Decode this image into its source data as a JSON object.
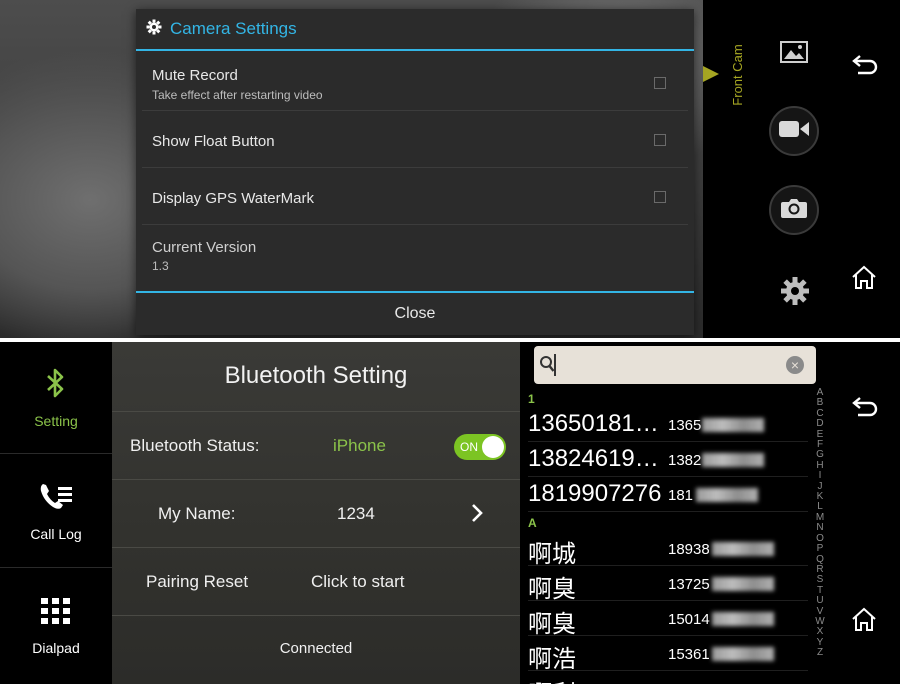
{
  "camera": {
    "dialog": {
      "title": "Camera Settings",
      "items": [
        {
          "title": "Mute Record",
          "subtitle": "Take effect after restarting video",
          "checked": false
        },
        {
          "title": "Show Float Button",
          "subtitle": "",
          "checked": false
        },
        {
          "title": "Display GPS WaterMark",
          "subtitle": "",
          "checked": false
        },
        {
          "title": "Current Version",
          "subtitle": "1.3"
        }
      ],
      "close_label": "Close"
    },
    "side": {
      "front_cam_label": "Front Cam",
      "icons": [
        "gallery-icon",
        "video-camera-icon",
        "camera-icon",
        "gear-icon",
        "back-icon",
        "home-icon"
      ]
    }
  },
  "bluetooth": {
    "nav": [
      {
        "label": "Setting",
        "icon": "bluetooth-icon",
        "active": true
      },
      {
        "label": "Call Log",
        "icon": "call-log-icon",
        "active": false
      },
      {
        "label": "Dialpad",
        "icon": "dialpad-icon",
        "active": false
      }
    ],
    "title": "Bluetooth Setting",
    "status_label": "Bluetooth Status:",
    "status_value": "iPhone",
    "toggle_label": "ON",
    "my_name_label": "My Name:",
    "my_name_value": "1234",
    "pairing_reset_label": "Pairing Reset",
    "pairing_reset_action": "Click to start",
    "connection_status": "Connected"
  },
  "contacts": {
    "search": {
      "placeholder": ""
    },
    "groups": [
      {
        "header": "1",
        "entries": [
          {
            "name": "13650181…",
            "number": "1365"
          },
          {
            "name": "13824619…",
            "number": "1382"
          },
          {
            "name": "1819907276",
            "number": "181"
          }
        ]
      },
      {
        "header": "A",
        "entries": [
          {
            "name": "啊城",
            "number": "18938"
          },
          {
            "name": "啊臭",
            "number": "13725"
          },
          {
            "name": "啊臭",
            "number": "15014"
          },
          {
            "name": "啊浩",
            "number": "15361"
          },
          {
            "name": "啊利",
            "number": ""
          }
        ]
      }
    ],
    "index_letters": [
      "A",
      "B",
      "C",
      "D",
      "E",
      "F",
      "G",
      "H",
      "I",
      "J",
      "K",
      "L",
      "M",
      "N",
      "O",
      "P",
      "Q",
      "R",
      "S",
      "T",
      "U",
      "V",
      "W",
      "X",
      "Y",
      "Z"
    ]
  },
  "colors": {
    "accent_blue": "#33b5e5",
    "accent_green": "#8bc34a",
    "front_cam": "#a6a623"
  }
}
